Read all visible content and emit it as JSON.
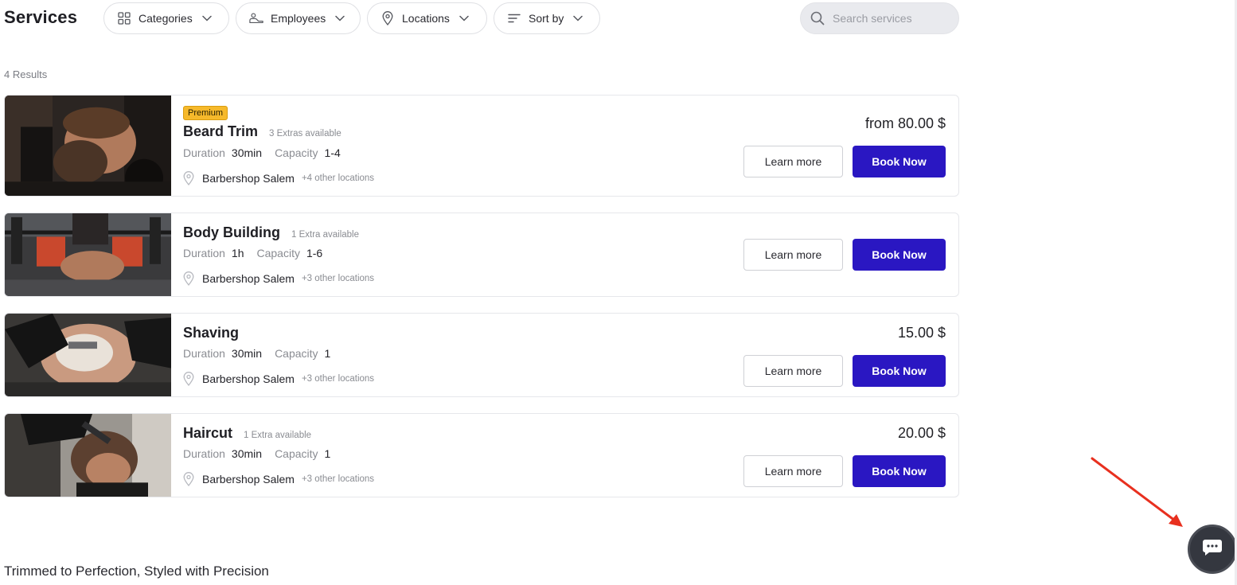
{
  "header": {
    "title": "Services",
    "filters": [
      {
        "label": "Categories",
        "icon": "grid-icon"
      },
      {
        "label": "Employees",
        "icon": "employees-icon"
      },
      {
        "label": "Locations",
        "icon": "location-pin-icon"
      },
      {
        "label": "Sort by",
        "icon": "sort-icon"
      }
    ],
    "search": {
      "placeholder": "Search services",
      "value": ""
    }
  },
  "results": {
    "count_label": "4 Results"
  },
  "services": [
    {
      "badge": "Premium",
      "name": "Beard Trim",
      "extras": "3 Extras available",
      "duration_label": "Duration",
      "duration": "30min",
      "capacity_label": "Capacity",
      "capacity": "1-4",
      "location": "Barbershop Salem",
      "other_locations": "+4 other locations",
      "price": "from 80.00 $",
      "learn_more": "Learn more",
      "book_now": "Book Now"
    },
    {
      "badge": "",
      "name": "Body Building",
      "extras": "1 Extra available",
      "duration_label": "Duration",
      "duration": "1h",
      "capacity_label": "Capacity",
      "capacity": "1-6",
      "location": "Barbershop Salem",
      "other_locations": "+3 other locations",
      "price": "",
      "learn_more": "Learn more",
      "book_now": "Book Now"
    },
    {
      "badge": "",
      "name": "Shaving",
      "extras": "",
      "duration_label": "Duration",
      "duration": "30min",
      "capacity_label": "Capacity",
      "capacity": "1",
      "location": "Barbershop Salem",
      "other_locations": "+3 other locations",
      "price": "15.00 $",
      "learn_more": "Learn more",
      "book_now": "Book Now"
    },
    {
      "badge": "",
      "name": "Haircut",
      "extras": "1 Extra available",
      "duration_label": "Duration",
      "duration": "30min",
      "capacity_label": "Capacity",
      "capacity": "1",
      "location": "Barbershop Salem",
      "other_locations": "+3 other locations",
      "price": "20.00 $",
      "learn_more": "Learn more",
      "book_now": "Book Now"
    }
  ],
  "footer": {
    "tagline": "Trimmed to Perfection, Styled with Precision"
  },
  "chat": {
    "icon": "chat-bubble-icon"
  },
  "colors": {
    "primary": "#2a17c2",
    "badge": "#f6b92b",
    "annotation_arrow": "#e8301f",
    "chat": "#34373f"
  }
}
